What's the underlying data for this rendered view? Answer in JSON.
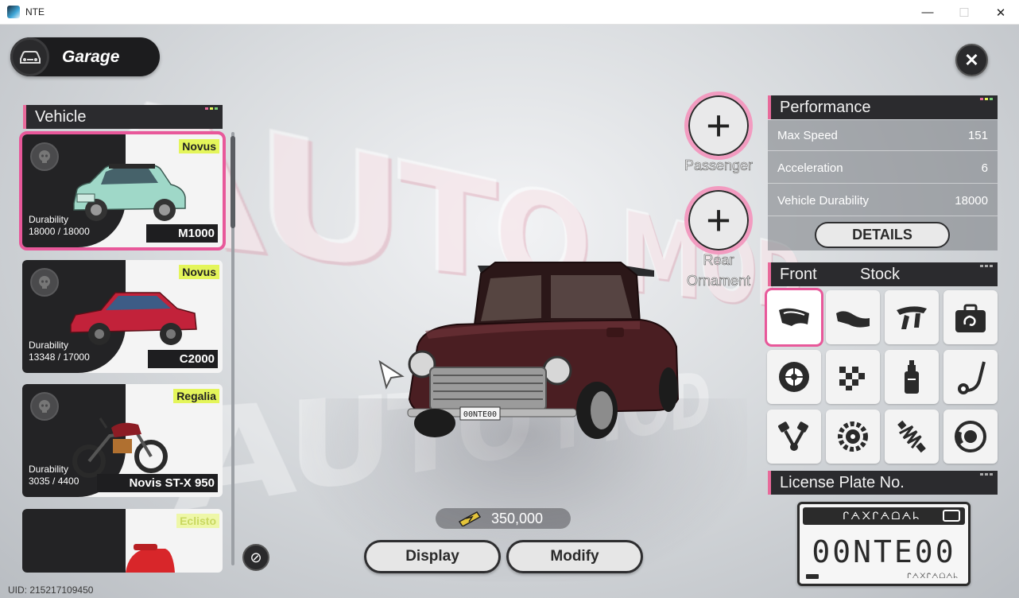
{
  "window": {
    "title": "NTE",
    "min": "—",
    "max": "☐",
    "close": "✕"
  },
  "garage": {
    "title": "Garage"
  },
  "close_label": "✕",
  "vehicle_section": {
    "title": "Vehicle"
  },
  "vehicles": [
    {
      "maker": "Novus",
      "durability_label": "Durability",
      "durability": "18000 / 18000",
      "model": "M1000",
      "color": "#9fd8c8"
    },
    {
      "maker": "Novus",
      "durability_label": "Durability",
      "durability": "13348 / 17000",
      "model": "C2000",
      "color": "#c2223a"
    },
    {
      "maker": "Regalia",
      "durability_label": "Durability",
      "durability": "3035 / 4400",
      "model": "Novis ST-X 950",
      "color": "#8c1c24"
    },
    {
      "maker": "Eclisto",
      "color": "#d8262a"
    }
  ],
  "price": {
    "value": "350,000"
  },
  "buttons": {
    "display": "Display",
    "modify": "Modify",
    "details": "DETAILS"
  },
  "slots": [
    {
      "label": "Passenger"
    },
    {
      "label": "Rear\nOrnament"
    }
  ],
  "performance": {
    "title": "Performance",
    "rows": [
      {
        "label": "Max Speed",
        "value": "151"
      },
      {
        "label": "Acceleration",
        "value": "6"
      },
      {
        "label": "Vehicle Durability",
        "value": "18000"
      }
    ]
  },
  "parts": {
    "title": "Front",
    "status": "Stock",
    "items": [
      "front-bumper-icon",
      "rear-bumper-icon",
      "spoiler-icon",
      "accessory-bag-icon",
      "wheel-icon",
      "checkered-paint-icon",
      "spray-paint-icon",
      "exhaust-icon",
      "engine-piston-icon",
      "transmission-gear-icon",
      "suspension-spring-icon",
      "brake-disc-icon"
    ]
  },
  "license": {
    "title": "License Plate No.",
    "plate_header": "ᒋᗅ᙭ᒋᗅᗝᗅᖺ",
    "number": "00NTE00",
    "plate_footer": "ᒋᗅ᙭ᒋᗅᗝᗅᖺ"
  },
  "uid": "UID: 215217109450",
  "car_plate": "00NTE00",
  "bg_text": "AUTO MOD",
  "colors": {
    "accent_pink": "#e8589a",
    "maker_yellow": "#e4f55a",
    "car_body": "#4a1e22"
  }
}
